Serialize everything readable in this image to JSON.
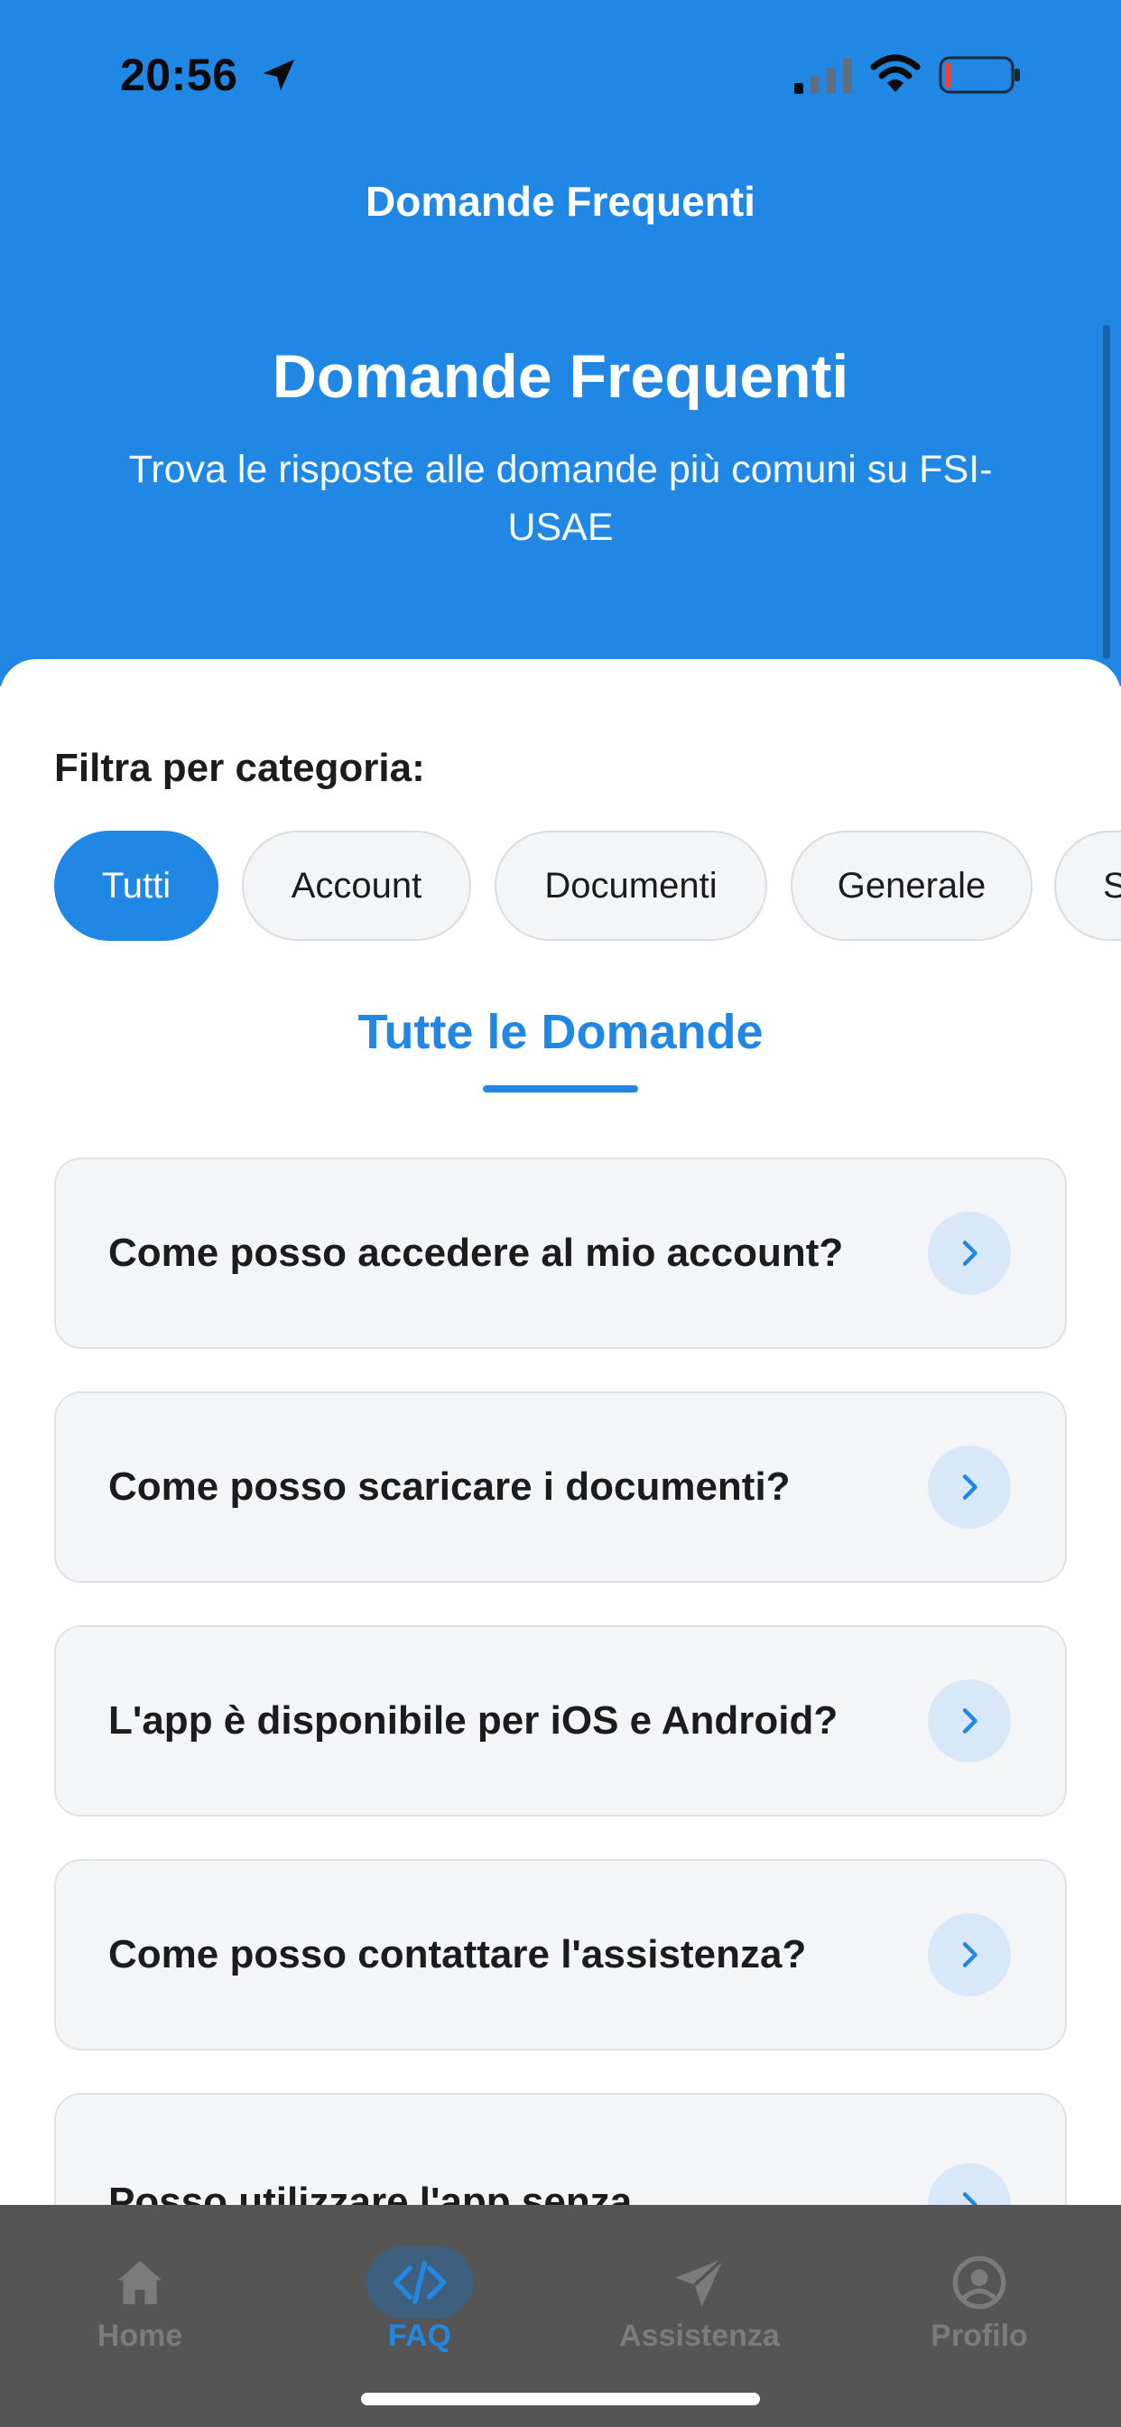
{
  "status_bar": {
    "time": "20:56"
  },
  "header": {
    "nav_title": "Domande Frequenti",
    "hero_title": "Domande Frequenti",
    "hero_subtitle": "Trova le risposte alle domande più comuni su FSI-USAE"
  },
  "filter": {
    "label": "Filtra per categoria:",
    "chips": [
      {
        "label": "Tutti",
        "active": true
      },
      {
        "label": "Account",
        "active": false
      },
      {
        "label": "Documenti",
        "active": false
      },
      {
        "label": "Generale",
        "active": false
      },
      {
        "label": "S",
        "active": false
      }
    ]
  },
  "section": {
    "title": "Tutte le Domande"
  },
  "faqs": [
    {
      "question": "Come posso accedere al mio account?"
    },
    {
      "question": "Come posso scaricare i documenti?"
    },
    {
      "question": "L'app è disponibile per iOS e Android?"
    },
    {
      "question": "Come posso contattare l'assistenza?"
    },
    {
      "question": "Posso utilizzare l'app senza"
    }
  ],
  "tabbar": {
    "tabs": [
      {
        "label": "Home",
        "icon": "home-icon",
        "active": false
      },
      {
        "label": "FAQ",
        "icon": "code-icon",
        "active": true
      },
      {
        "label": "Assistenza",
        "icon": "send-icon",
        "active": false
      },
      {
        "label": "Profilo",
        "icon": "user-circle-icon",
        "active": false
      }
    ]
  },
  "colors": {
    "primary": "#2087e4",
    "tabbar_bg": "#555555",
    "card_bg": "#f4f5f6"
  }
}
